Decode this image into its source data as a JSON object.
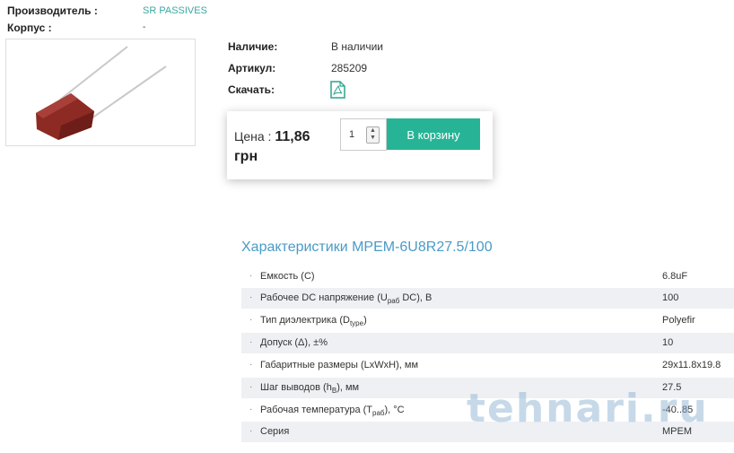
{
  "header": {
    "manufacturer_label": "Производитель :",
    "manufacturer_value": "SR PASSIVES",
    "case_label": "Корпус :",
    "case_value": "-"
  },
  "info": {
    "availability_label": "Наличие:",
    "availability_value": "В наличии",
    "sku_label": "Артикул:",
    "sku_value": "285209",
    "download_label": "Скачать:",
    "download_icon": "pdf-icon"
  },
  "price": {
    "label": "Цена :",
    "value": "11,86",
    "currency": "грн",
    "quantity": "1",
    "cart_button": "В корзину"
  },
  "specs": {
    "title": "Характеристики MPEM-6U8R27.5/100",
    "rows": [
      {
        "name": "Емкость (C)",
        "value": "6.8uF"
      },
      {
        "name_pre": "Рабочее DC напряжение (U",
        "name_sub": "раб",
        "name_post": " DC), В",
        "value": "100"
      },
      {
        "name_pre": "Тип диэлектрика (D",
        "name_sub": "type",
        "name_post": ")",
        "value": "Polyefir"
      },
      {
        "name": "Допуск (Δ), ±%",
        "value": "10"
      },
      {
        "name": "Габаритные размеры (LxWxH), мм",
        "value": "29x11.8x19.8"
      },
      {
        "name_pre": "Шаг выводов (h",
        "name_sub": "B",
        "name_post": "), мм",
        "value": "27.5"
      },
      {
        "name_pre": "Рабочая температура (T",
        "name_sub": "раб",
        "name_post": "), °C",
        "value": "-40..85"
      },
      {
        "name": "Серия",
        "value": "MPEM"
      }
    ]
  },
  "watermark": "tehnari.ru",
  "colors": {
    "accent": "#27b496",
    "link": "#3aa8a0",
    "spec_title": "#4a9bc6",
    "row_alt": "#eef0f4"
  }
}
